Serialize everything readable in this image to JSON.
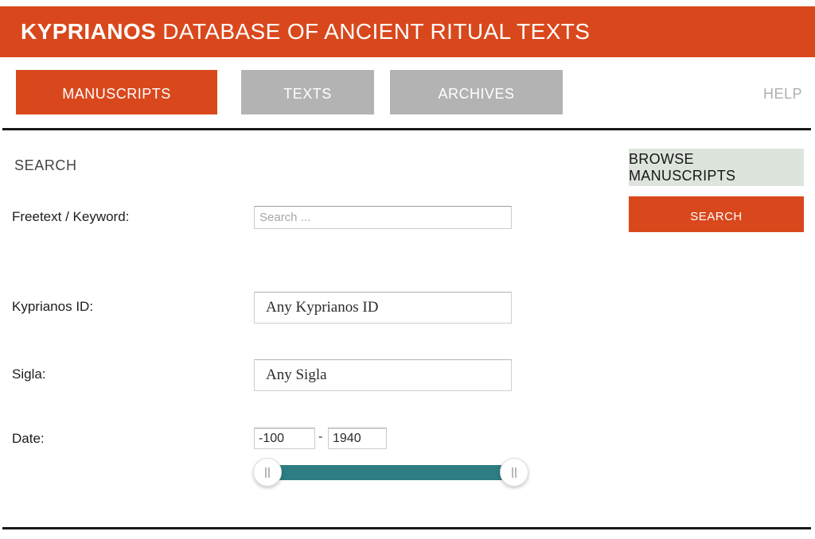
{
  "banner": {
    "brand": "KYPRIANOS",
    "rest": " DATABASE OF ANCIENT RITUAL TEXTS"
  },
  "nav": {
    "tabs": [
      {
        "label": "MANUSCRIPTS",
        "active": true
      },
      {
        "label": "TEXTS",
        "active": false
      },
      {
        "label": "ARCHIVES",
        "active": false
      }
    ],
    "help_label": "HELP"
  },
  "search": {
    "heading": "SEARCH",
    "fields": {
      "freetext": {
        "label": "Freetext / Keyword:",
        "placeholder": "Search ...",
        "value": ""
      },
      "kyprianos_id": {
        "label": "Kyprianos ID:",
        "value": "Any Kyprianos ID"
      },
      "sigla": {
        "label": "Sigla:",
        "value": "Any Sigla"
      },
      "date": {
        "label": "Date:",
        "from": "-100",
        "to": "1940",
        "separator": "-"
      }
    }
  },
  "actions": {
    "browse_label": "BROWSE MANUSCRIPTS",
    "search_label": "SEARCH"
  },
  "colors": {
    "accent_orange": "#d9481c",
    "tab_gray": "#b3b3b3",
    "browse_green": "#dde4dc",
    "slider_teal": "#2d7d83"
  }
}
